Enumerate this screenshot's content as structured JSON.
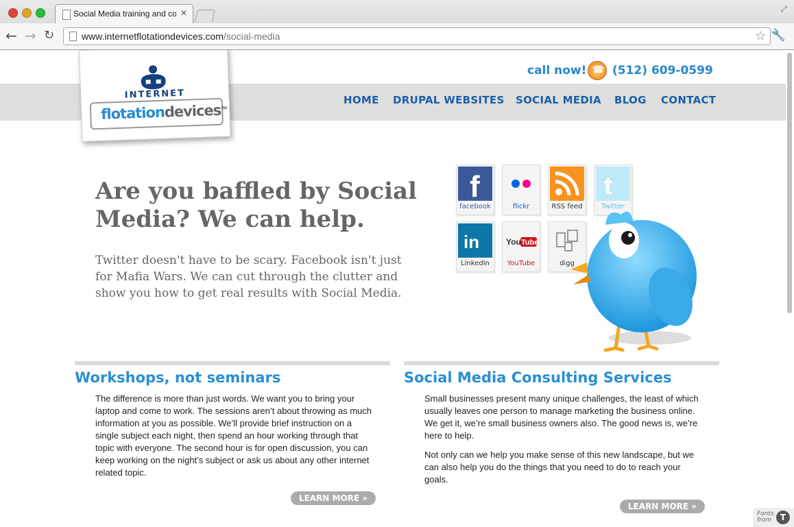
{
  "browser": {
    "tab_title": "Social Media training and cor",
    "url_domain": "www.internetflotationdevices.com",
    "url_path": "/social-media"
  },
  "logo": {
    "top_word": "INTERNET",
    "word_a": "flotation",
    "word_b": "devices",
    "tm": "TM"
  },
  "header": {
    "call_label": "call now!",
    "phone": "(512) 609-0599"
  },
  "nav": {
    "items": [
      "HOME",
      "DRUPAL WEBSITES",
      "SOCIAL MEDIA",
      "BLOG",
      "CONTACT"
    ]
  },
  "hero": {
    "headline": "Are you baffled by Social Media? We can help.",
    "intro": "Twitter doesn't have to be scary. Facebook isn't just for Mafia Wars. We can cut through the clutter and show you how to get real results with Social Media."
  },
  "social_tiles": [
    {
      "label": "facebook",
      "icon": "facebook-icon",
      "color": "#3b5998"
    },
    {
      "label": "flickr",
      "icon": "flickr-icon",
      "color": "#ff0084"
    },
    {
      "label": "RSS feed",
      "icon": "rss-icon",
      "color": "#f7931e"
    },
    {
      "label": "Twitter",
      "icon": "twitter-icon",
      "color": "#55c5ef"
    },
    {
      "label": "LinkedIn",
      "icon": "linkedin-icon",
      "color": "#0e76a8"
    },
    {
      "label": "YouTube",
      "icon": "youtube-icon",
      "color": "#cc181e"
    },
    {
      "label": "digg",
      "icon": "digg-icon",
      "color": "#888888"
    }
  ],
  "sections": [
    {
      "title": "Workshops, not seminars",
      "paragraphs": [
        "The difference is more than just words. We want you to bring your laptop and come to work. The sessions aren’t about throwing as much information at you as possible. We’ll provide brief instruction on a single subject each night, then spend an hour working through that topic with everyone. The second hour is for open discussion, you can keep working on the night’s subject or ask us about any other internet related topic."
      ],
      "button": "LEARN MORE »"
    },
    {
      "title": "Social Media Consulting Services",
      "paragraphs": [
        "Small businesses present many unique challenges, the least of which usually leaves one person to manage marketing the business online. We get it, we’re small business owners also. The good news is, we’re here to help.",
        "Not only can we help you make sense of this new landscape, but we can also help you do the things that you need to do to reach your goals."
      ],
      "button": "LEARN MORE »"
    }
  ],
  "fonts_badge": {
    "line1": "Fonts",
    "line2": "from"
  },
  "colors": {
    "brand_blue": "#2a8fd2",
    "nav_blue": "#1b5fa5",
    "heading_gray": "#666666"
  }
}
